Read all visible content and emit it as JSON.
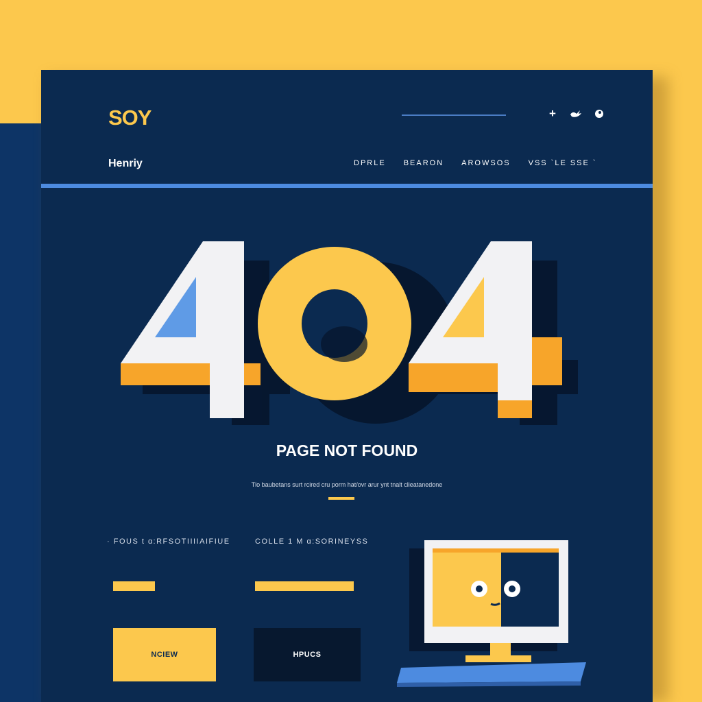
{
  "header": {
    "logo": "SOY",
    "brand": "Henriy",
    "icons": [
      "plus-icon",
      "bird-icon",
      "circle-icon"
    ]
  },
  "nav": {
    "items": [
      "DPRLE",
      "BEARON",
      "AROWSOS",
      "VSS `LE SSE `"
    ]
  },
  "hero": {
    "code": "404",
    "title": "PAGE NOT FOUND",
    "description": "Tlo baubetans surt rcired cru  porm hat/ovr arur ynt tnalt clieatanedone"
  },
  "footer": {
    "label_left": "· FOUS  t  ɑ:RFSOTIIIIAIFIUE",
    "label_right": "COLLE  1  M  ɑ:SORINEYSS",
    "button_left": "NCIEW",
    "button_right": "HPUCS"
  },
  "colors": {
    "background": "#fcc84d",
    "page": "#0b2a50",
    "accent_yellow": "#fcc84d",
    "accent_blue": "#4d8be0",
    "white": "#f2f2f4",
    "orange": "#f7a52a"
  }
}
